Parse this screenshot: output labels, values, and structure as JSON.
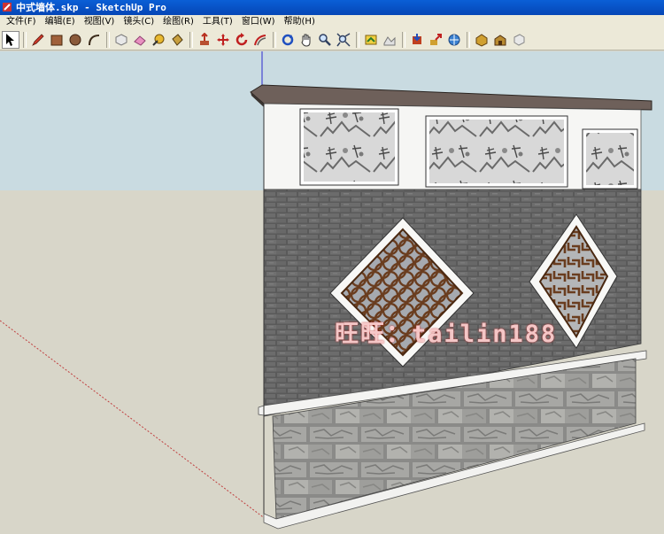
{
  "window": {
    "title": "中式墙体.skp - SketchUp Pro"
  },
  "menu": [
    "文件(F)",
    "编辑(E)",
    "视图(V)",
    "镜头(C)",
    "绘图(R)",
    "工具(T)",
    "窗口(W)",
    "帮助(H)"
  ],
  "toolbar": {
    "groups": [
      [
        "select-icon"
      ],
      [
        "pencil-icon",
        "rectangle-icon",
        "circle-icon",
        "arc-icon"
      ],
      [
        "make-component-icon",
        "eraser-icon",
        "tape-measure-icon",
        "paint-bucket-icon"
      ],
      [
        "push-pull-icon",
        "move-icon",
        "rotate-icon",
        "offset-icon"
      ],
      [
        "orbit-icon",
        "pan-icon",
        "zoom-icon",
        "zoom-extents-icon"
      ],
      [
        "add-location-icon",
        "toggle-terrain-icon"
      ],
      [
        "get-models-icon",
        "share-model-icon",
        "share-component-icon"
      ],
      [
        "photo-textures-icon",
        "warehouse-icon",
        "extension-icon"
      ]
    ]
  },
  "watermark": "旺旺：tailin188",
  "colors": {
    "title_bar": "#0546b6",
    "sky": "#c9dbe1",
    "ground": "#d8d6c9",
    "brick": "#565656",
    "stone": "#9a9a98"
  }
}
